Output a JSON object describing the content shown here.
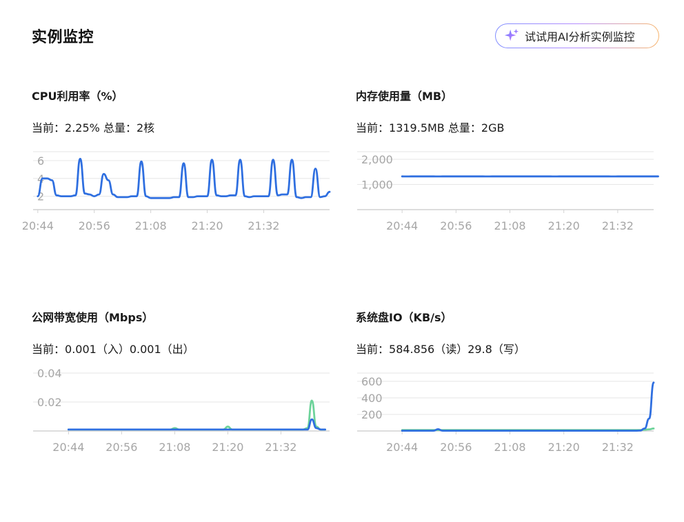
{
  "page": {
    "title": "实例监控",
    "ai_button_label": "试试用AI分析实例监控"
  },
  "colors": {
    "series_primary": "#2f6fe0",
    "series_secondary": "#6dd39a",
    "grid": "#e6e6e6",
    "axis": "#d2d2d2",
    "tick_text": "#a6a6a6"
  },
  "panels": [
    {
      "title": "CPU利用率（%）",
      "current_prefix": "当前：",
      "current_value": "2.25%",
      "total_label": "总量：",
      "total_value": "2核"
    },
    {
      "title": "内存使用量（MB）",
      "current_prefix": "当前：",
      "current_value": "1319.5MB",
      "total_label": "总量：",
      "total_value": "2GB"
    },
    {
      "title": "公网带宽使用（Mbps）",
      "current_prefix": "当前：",
      "current_value": "0.001",
      "current_suffix": "（入）",
      "second_value": "0.001",
      "second_suffix": "（出）"
    },
    {
      "title": "系统盘IO（KB/s）",
      "current_prefix": "当前：",
      "current_value": "584.856",
      "current_suffix": "（读）",
      "second_value": "29.8",
      "second_suffix": "（写）"
    }
  ],
  "chart_data": [
    {
      "type": "line",
      "x_labels": [
        "20:44",
        "20:56",
        "21:08",
        "21:20",
        "21:32"
      ],
      "x_range": [
        -1,
        62
      ],
      "y_ticks": [
        "2",
        "4",
        "6"
      ],
      "y_tick_values": [
        2,
        4,
        6
      ],
      "ylim": [
        0.5,
        7
      ],
      "grid": true,
      "series": [
        {
          "color": "#2f6fe0",
          "values": [
            2.0,
            4.0,
            4.0,
            3.8,
            2.1,
            2.0,
            2.0,
            2.0,
            2.1,
            6.2,
            2.3,
            2.2,
            2.0,
            2.2,
            4.5,
            3.8,
            2.2,
            1.9,
            1.9,
            1.9,
            2.0,
            2.0,
            5.9,
            2.0,
            1.8,
            1.8,
            1.8,
            1.8,
            1.8,
            1.9,
            1.9,
            5.7,
            1.9,
            1.9,
            2.0,
            2.0,
            2.0,
            6.1,
            2.1,
            2.0,
            2.0,
            2.1,
            2.1,
            6.1,
            2.0,
            1.9,
            2.0,
            2.0,
            2.0,
            2.0,
            6.1,
            2.1,
            2.2,
            2.2,
            6.1,
            1.9,
            1.8,
            1.9,
            1.9,
            5.1,
            1.9,
            2.0,
            2.5
          ]
        }
      ]
    },
    {
      "type": "line",
      "x_labels": [
        "20:44",
        "20:56",
        "21:08",
        "21:20",
        "21:32"
      ],
      "x_range": [
        -10,
        56
      ],
      "y_ticks": [
        "1,000",
        "2,000"
      ],
      "y_tick_values": [
        1000,
        2000
      ],
      "ylim": [
        0,
        2300
      ],
      "grid": true,
      "series": [
        {
          "color": "#2f6fe0",
          "values": [
            1320,
            1318,
            1319,
            1320,
            1319,
            1319,
            1320,
            1319,
            1318,
            1319,
            1319,
            1320,
            1319,
            1319,
            1319,
            1320,
            1319,
            1319,
            1319,
            1318,
            1319,
            1319,
            1319,
            1320,
            1319,
            1319,
            1319,
            1319,
            1320,
            1319,
            1319,
            1320,
            1319,
            1319,
            1318,
            1319,
            1319,
            1319,
            1320,
            1319,
            1319,
            1319,
            1320,
            1319,
            1319,
            1319,
            1319,
            1318,
            1319,
            1319,
            1319,
            1319,
            1319,
            1320,
            1319,
            1319,
            1320,
            1319.5
          ]
        }
      ]
    },
    {
      "type": "line",
      "x_labels": [
        "20:44",
        "20:56",
        "21:08",
        "21:20",
        "21:32"
      ],
      "x_range": [
        -8,
        59
      ],
      "y_ticks": [
        "0.02",
        "0.04"
      ],
      "y_tick_values": [
        0.02,
        0.04
      ],
      "ylim": [
        0,
        0.04
      ],
      "grid": true,
      "series": [
        {
          "color": "#6dd39a",
          "values": [
            0.001,
            0.001,
            0.001,
            0.001,
            0.001,
            0.001,
            0.001,
            0.001,
            0.001,
            0.001,
            0.001,
            0.001,
            0.001,
            0.001,
            0.001,
            0.001,
            0.001,
            0.001,
            0.001,
            0.001,
            0.001,
            0.001,
            0.001,
            0.001,
            0.002,
            0.001,
            0.001,
            0.001,
            0.001,
            0.001,
            0.001,
            0.001,
            0.001,
            0.001,
            0.001,
            0.001,
            0.003,
            0.001,
            0.001,
            0.001,
            0.001,
            0.001,
            0.001,
            0.001,
            0.001,
            0.001,
            0.001,
            0.001,
            0.001,
            0.001,
            0.001,
            0.001,
            0.001,
            0.001,
            0.002,
            0.021,
            0.003,
            0.001,
            0.001
          ]
        },
        {
          "color": "#2f6fe0",
          "values": [
            0.001,
            0.001,
            0.001,
            0.001,
            0.001,
            0.001,
            0.001,
            0.001,
            0.001,
            0.001,
            0.001,
            0.001,
            0.001,
            0.001,
            0.001,
            0.001,
            0.001,
            0.001,
            0.001,
            0.001,
            0.001,
            0.001,
            0.001,
            0.001,
            0.001,
            0.001,
            0.001,
            0.001,
            0.001,
            0.001,
            0.001,
            0.001,
            0.001,
            0.001,
            0.001,
            0.001,
            0.001,
            0.001,
            0.001,
            0.001,
            0.001,
            0.001,
            0.001,
            0.001,
            0.001,
            0.001,
            0.001,
            0.001,
            0.001,
            0.001,
            0.001,
            0.001,
            0.001,
            0.001,
            0.001,
            0.008,
            0.002,
            0.001,
            0.001
          ]
        }
      ]
    },
    {
      "type": "line",
      "x_labels": [
        "20:44",
        "20:56",
        "21:08",
        "21:20",
        "21:32"
      ],
      "x_range": [
        -10,
        56
      ],
      "y_ticks": [
        "200",
        "400",
        "600"
      ],
      "y_tick_values": [
        200,
        400,
        600
      ],
      "ylim": [
        0,
        700
      ],
      "grid": true,
      "series": [
        {
          "color": "#6dd39a",
          "values": [
            12,
            12,
            12,
            12,
            12,
            12,
            12,
            12,
            12,
            12,
            12,
            12,
            12,
            12,
            12,
            12,
            12,
            12,
            12,
            12,
            12,
            12,
            12,
            12,
            12,
            12,
            12,
            12,
            12,
            12,
            12,
            12,
            12,
            12,
            12,
            12,
            12,
            12,
            12,
            12,
            12,
            12,
            12,
            12,
            12,
            12,
            12,
            12,
            12,
            12,
            12,
            12,
            12,
            12,
            15,
            20,
            29.8
          ]
        },
        {
          "color": "#2f6fe0",
          "values": [
            3,
            3,
            3,
            3,
            3,
            3,
            3,
            3,
            22,
            3,
            3,
            3,
            3,
            3,
            3,
            3,
            3,
            3,
            3,
            3,
            3,
            3,
            3,
            3,
            3,
            3,
            3,
            3,
            3,
            3,
            3,
            3,
            3,
            3,
            3,
            3,
            3,
            3,
            3,
            3,
            3,
            3,
            3,
            3,
            3,
            3,
            3,
            3,
            3,
            3,
            3,
            3,
            3,
            5,
            30,
            150,
            584.856
          ]
        }
      ]
    }
  ]
}
